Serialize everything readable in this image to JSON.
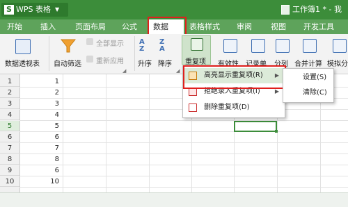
{
  "app": {
    "logo_letter": "S",
    "title": "WPS 表格",
    "document_name": "工作簿1 * - 我",
    "brand_color": "#3c8d3a"
  },
  "menu": {
    "items": [
      "开始",
      "插入",
      "页面布局",
      "公式",
      "数据",
      "表格样式",
      "审阅",
      "视图",
      "开发工具"
    ],
    "active": "数据"
  },
  "ribbon": {
    "pivot_table": "数据透视表",
    "auto_filter": "自动筛选",
    "show_all": "全部显示",
    "reapply": "重新应用",
    "sort_asc": "升序",
    "sort_desc": "降序",
    "duplicates": "重复项",
    "validity": "有效性",
    "record_form": "记录单",
    "split": "分列",
    "consolidate": "合并计算",
    "simulate": "模拟分",
    "icons": [
      "pivot-table-icon",
      "filter-funnel-icon",
      "show-all-icon",
      "reapply-icon",
      "sort-ascending-icon",
      "sort-descending-icon",
      "duplicates-icon",
      "validity-icon",
      "record-form-icon",
      "split-icon",
      "consolidate-icon",
      "simulate-icon"
    ]
  },
  "sheet": {
    "row_numbers": [
      "1",
      "2",
      "3",
      "4",
      "5",
      "6",
      "7",
      "8",
      "9",
      "10"
    ],
    "selected_row": "5",
    "column_a_values": [
      "1",
      "2",
      "3",
      "4",
      "5",
      "6",
      "7",
      "8",
      "6",
      "10"
    ]
  },
  "duplicates_menu": {
    "items": [
      {
        "label": "高亮显示重复项(R)",
        "icon": "highlight-duplicates-icon",
        "has_submenu": true
      },
      {
        "label": "拒绝录入重复项(I)",
        "icon": "reject-duplicates-icon",
        "has_submenu": true
      },
      {
        "label": "删除重复项(D)",
        "icon": "delete-duplicates-icon",
        "has_submenu": false
      }
    ],
    "submenu": [
      "设置(S)",
      "清除(C)"
    ]
  }
}
